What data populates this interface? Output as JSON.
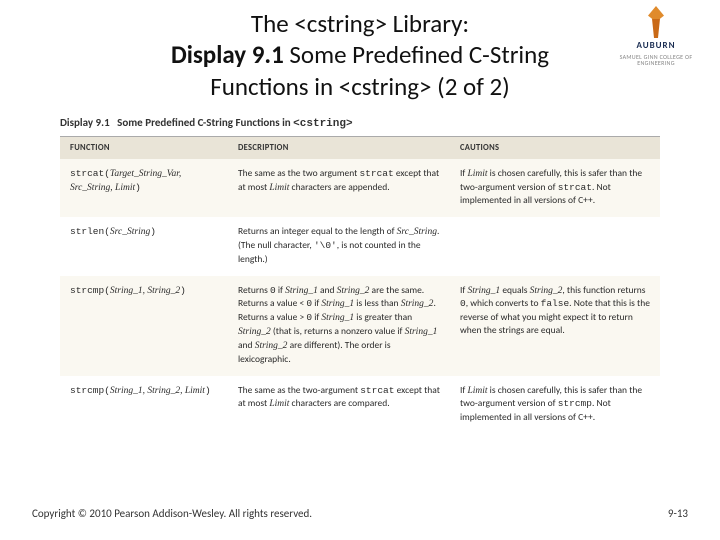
{
  "title": {
    "line1_pre": "The ",
    "line1_code": "<cstring>",
    "line1_post": " Library:",
    "line2_bold": "Display 9.1",
    "line2_rest": "  Some Predefined C-String",
    "line3_pre": "Functions in ",
    "line3_code": "<cstring>",
    "line3_post": " (2 of 2)"
  },
  "logo": {
    "university": "AUBURN",
    "subline": "SAMUEL GINN COLLEGE OF ENGINEERING"
  },
  "caption": {
    "display": "Display 9.1",
    "title_pre": "Some Predefined C-String Functions in ",
    "title_code": "<cstring>"
  },
  "columns": {
    "func": "FUNCTION",
    "desc": "DESCRIPTION",
    "caut": "CAUTIONS"
  },
  "rows": [
    {
      "func_html": "<span class='mono'>strcat(</span><span class='ital'>Target_String_Var, Src_String, Limit</span><span class='mono'>)</span>",
      "desc_html": "The same as the two argument <span class='mono'>strcat</span> except that at most <span class='ital'>Limit</span> characters are appended.",
      "caut_html": "If <span class='ital'>Limit</span> is chosen carefully, this is safer than the two-argument version of <span class='mono'>strcat</span>. Not implemented in all versions of C++."
    },
    {
      "func_html": "<span class='mono'>strlen(</span><span class='ital'>Src_String</span><span class='mono'>)</span>",
      "desc_html": "Returns an integer equal to the length of <span class='ital'>Src_String</span>. (The null character, <span class='mono'>'\\0'</span>, is not counted in the length.)",
      "caut_html": ""
    },
    {
      "func_html": "<span class='mono'>strcmp(</span><span class='ital'>String_1, String_2</span><span class='mono'>)</span>",
      "desc_html": "Returns <span class='mono'>0</span> if <span class='ital'>String_1</span> and <span class='ital'>String_2</span> are the same. Returns a value &lt; <span class='mono'>0</span> if <span class='ital'>String_1</span> is less than <span class='ital'>String_2</span>. Returns a value &gt; <span class='mono'>0</span> if <span class='ital'>String_1</span> is greater than <span class='ital'>String_2</span> (that is, returns a nonzero value if <span class='ital'>String_1</span> and <span class='ital'>String_2</span> are different). The order is lexicographic.",
      "caut_html": "If <span class='ital'>String_1</span> equals <span class='ital'>String_2</span>, this function returns <span class='mono'>0</span>, which converts to <span class='mono'>false</span>. Note that this is the reverse of what you might expect it to return when the strings are equal."
    },
    {
      "func_html": "<span class='mono'>strcmp(</span><span class='ital'>String_1, String_2, Limit</span><span class='mono'>)</span>",
      "desc_html": "The same as the two-argument <span class='mono'>strcat</span> except that at most <span class='ital'>Limit</span> characters are compared.",
      "caut_html": "If <span class='ital'>Limit</span> is chosen carefully, this is safer than the two-argument version of <span class='mono'>strcmp</span>. Not implemented in all versions of C++."
    }
  ],
  "footer": {
    "copyright": "Copyright © 2010 Pearson Addison-Wesley. All rights reserved.",
    "pagenum": "9-13"
  }
}
